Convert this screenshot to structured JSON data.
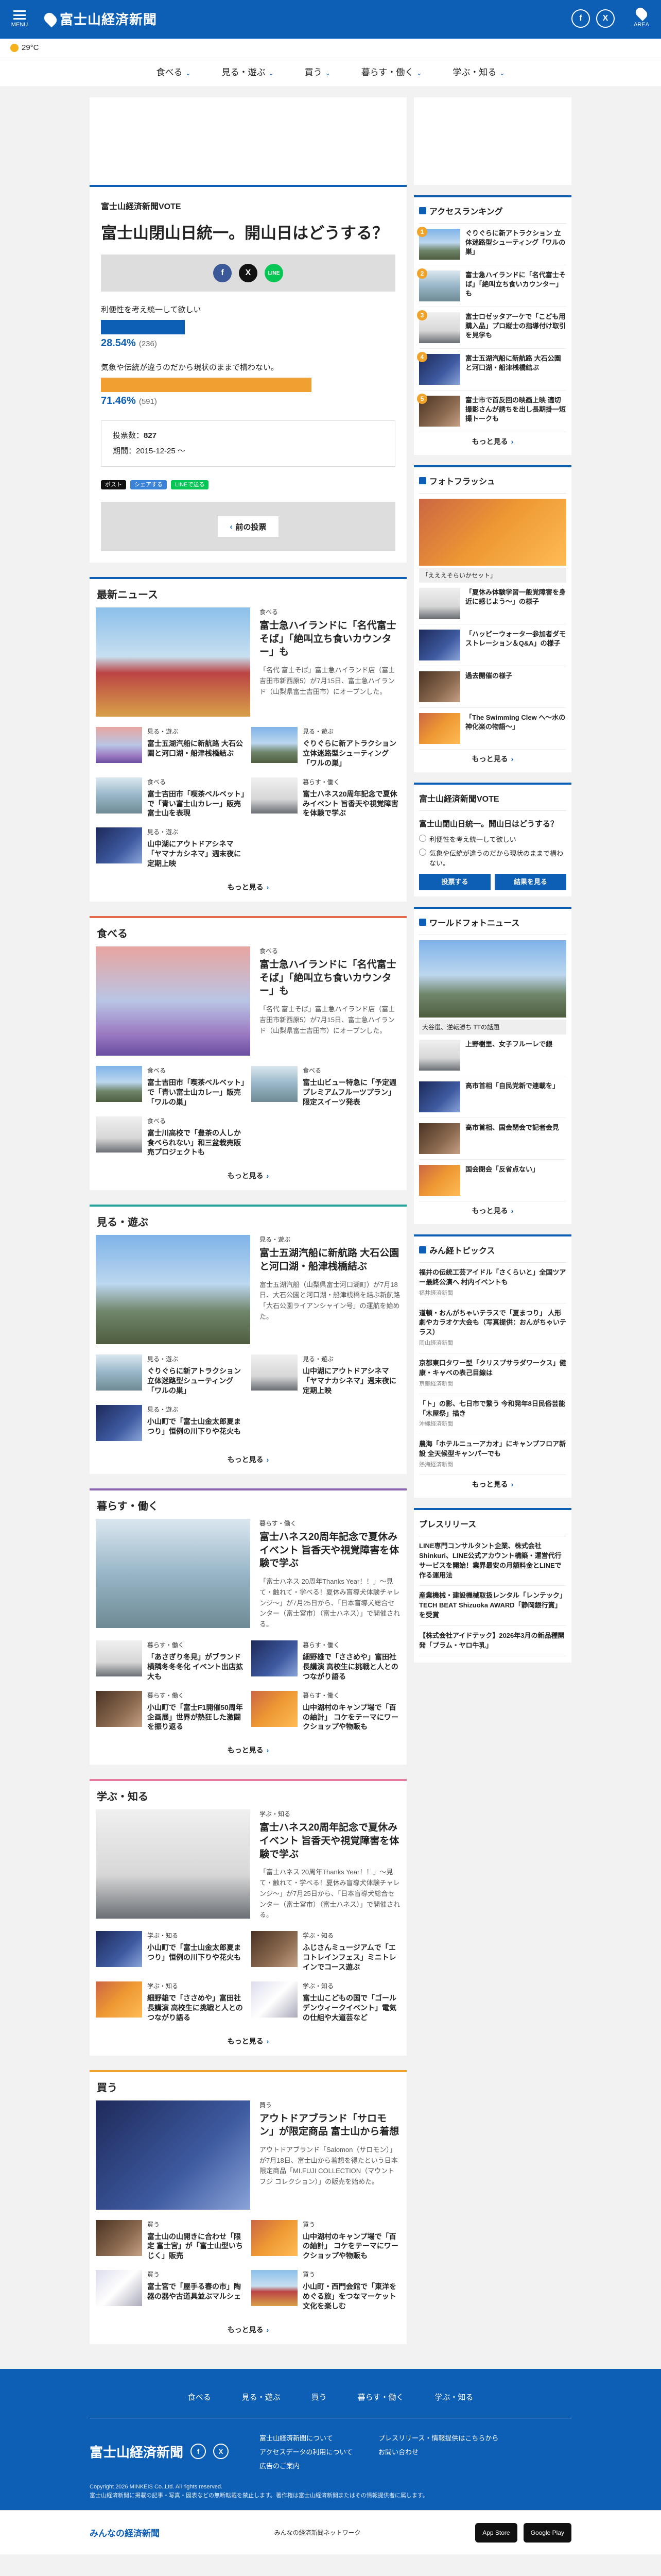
{
  "header": {
    "menu_label": "MENU",
    "site_name": "富士山経済新聞",
    "site_sub": "minkei",
    "area_label": "AREA",
    "sns": [
      "f",
      "X"
    ]
  },
  "weather": {
    "temp": "29°C"
  },
  "nav": [
    "食べる",
    "見る・遊ぶ",
    "買う",
    "暮らす・働く",
    "学ぶ・知る"
  ],
  "vote": {
    "label": "富士山経済新聞VOTE",
    "question": "富士山閉山日統一。開山日はどうする？",
    "share_icons": [
      "f",
      "X",
      "LINE"
    ],
    "options": [
      {
        "text": "利便性を考え統一して欲しい",
        "pct": "28.54%",
        "count": "(236)",
        "ratio": 0.2854,
        "color": "#0d5fb5"
      },
      {
        "text": "気象や伝統が違うのだから現状のままで構わない。",
        "pct": "71.46%",
        "count": "(591)",
        "ratio": 0.7146,
        "color": "#f0a030"
      }
    ],
    "total_label": "投票数：",
    "total": "827",
    "period": "期間：2015-12-25 〜",
    "mini": [
      "ポスト",
      "シェアする",
      "LINEで送る"
    ],
    "prev": "前の投票"
  },
  "sections": [
    {
      "key": "news",
      "cls": "",
      "title": "最新ニュース",
      "lead": {
        "cat": "食べる",
        "title": "富士急ハイランドに「名代富士そば」「絶叫立ち食いカウンター」も",
        "desc": "「名代 富士そば」富士急ハイランド店（富士吉田市新西原5）が7月15日、富士急ハイランド（山梨県富士吉田市）にオープンした。"
      },
      "items": [
        {
          "cat": "見る・遊ぶ",
          "title": "富士五湖汽船に新航路 大石公園と河口湖・船津桟橋結ぶ"
        },
        {
          "cat": "見る・遊ぶ",
          "title": "ぐりぐらに新アトラクション 立体迷路型シューティング「ワルの巣」"
        },
        {
          "cat": "食べる",
          "title": "富士吉田市「喫茶ベルベット」で「青い富士山カレー」販売 富士山を表現"
        },
        {
          "cat": "暮らす・働く",
          "title": "富士ハネス20周年記念で夏休みイベント 旨香天や視覚障害を体験で学ぶ"
        },
        {
          "cat": "見る・遊ぶ",
          "title": "山中湖にアウトドアシネマ「ヤマナカシネマ」週末夜に定期上映"
        }
      ]
    },
    {
      "key": "eat",
      "cls": "c-eat",
      "title": "食べる",
      "lead": {
        "cat": "食べる",
        "title": "富士急ハイランドに「名代富士そば」「絶叫立ち食いカウンター」も",
        "desc": "「名代 富士そば」富士急ハイランド店（富士吉田市新西原5）が7月15日、富士急ハイランド（山梨県富士吉田市）にオープンした。"
      },
      "items": [
        {
          "cat": "食べる",
          "title": "富士吉田市「喫茶ベルベット」で「青い富士山カレー」販売 「ワルの巣」"
        },
        {
          "cat": "食べる",
          "title": "富士山ビュー特急に「予定週プレミアムフルーツプラン」限定スイーツ発表"
        },
        {
          "cat": "食べる",
          "title": "富士川高校で「豊茶の人しか食べられない」和三盆栽売販売プロジェクトも"
        }
      ]
    },
    {
      "key": "play",
      "cls": "c-play",
      "title": "見る・遊ぶ",
      "lead": {
        "cat": "見る・遊ぶ",
        "title": "富士五湖汽船に新航路 大石公園と河口湖・船津桟橋結ぶ",
        "desc": "富士五湖汽船（山梨県富士河口湖町）が7月18日、大石公園と河口湖・船津桟橋を結ぶ新航路「大石公園ライアンシャイン号」の運航を始めた。"
      },
      "items": [
        {
          "cat": "見る・遊ぶ",
          "title": "ぐりぐらに新アトラクション 立体迷路型シューティング「ワルの巣」"
        },
        {
          "cat": "見る・遊ぶ",
          "title": "山中湖にアウトドアシネマ「ヤマナカシネマ」週末夜に定期上映"
        },
        {
          "cat": "見る・遊ぶ",
          "title": "小山町で「富士山金太郎夏まつり」恒例の川下りや花火も"
        }
      ]
    },
    {
      "key": "live",
      "cls": "c-live",
      "title": "暮らす・働く",
      "lead": {
        "cat": "暮らす・働く",
        "title": "富士ハネス20周年記念で夏休みイベント 旨香天や視覚障害を体験で学ぶ",
        "desc": "「富士ハネス 20周年Thanks Year！！」〜見て・触れて・学べる！夏休み盲導犬体験チャレンジ〜」が7月25日から、「日本盲導犬総合センター（富士宮市）（富士ハネス）」で開催される。"
      },
      "items": [
        {
          "cat": "暮らす・働く",
          "title": "「あさぎり冬見」がブランド横隣冬冬冬化 イベント出店拡大も"
        },
        {
          "cat": "暮らす・働く",
          "title": "細野雄で「ささめや」富田社長講演 高校生に挑戦と人とのつながり語る"
        },
        {
          "cat": "暮らす・働く",
          "title": "小山町で「富士F1開催50周年企画展」世界が熱狂した激闘を振り返る"
        },
        {
          "cat": "暮らす・働く",
          "title": "山中湖村のキャンプ場で「百の紬計」 コケをテーマにワークショップや物販も"
        }
      ]
    },
    {
      "key": "learn",
      "cls": "c-learn",
      "title": "学ぶ・知る",
      "lead": {
        "cat": "学ぶ・知る",
        "title": "富士ハネス20周年記念で夏休みイベント 旨香天や視覚障害を体験で学ぶ",
        "desc": "「富士ハネス 20周年Thanks Year！！」〜見て・触れて・学べる！夏休み盲導犬体験チャレンジ〜」が7月25日から、「日本盲導犬総合センター（富士宮市）（富士ハネス）」で開催される。"
      },
      "items": [
        {
          "cat": "学ぶ・知る",
          "title": "小山町で「富士山金太郎夏まつり」恒例の川下りや花火も"
        },
        {
          "cat": "学ぶ・知る",
          "title": "ふじさんミュージアムで「エコトレインフェス」ミニトレインでコース遊ぶ"
        },
        {
          "cat": "学ぶ・知る",
          "title": "細野雄で「ささめや」富田社長講演 高校生に挑戦と人とのつながり語る"
        },
        {
          "cat": "学ぶ・知る",
          "title": "富士山こどもの国で「ゴールデンウィークイベント」電気の仕組や大道芸など"
        }
      ]
    },
    {
      "key": "buy",
      "cls": "c-buy",
      "title": "買う",
      "lead": {
        "cat": "買う",
        "title": "アウトドアブランド「サロモン」が限定商品 富士山から着想",
        "desc": "アウトドアブランド「Salomon（サロモン）」が7月18日、富士山から着想を得たという日本限定商品「MI.FUJI COLLECTION（マウントフジ コレクション）」の販売を始めた。"
      },
      "items": [
        {
          "cat": "買う",
          "title": "富士山の山開きに合わせ「限定 富士宮」が「富士山型いちじく」販売"
        },
        {
          "cat": "買う",
          "title": "山中湖村のキャンプ場で「百の紬計」 コケをテーマにワークショップや物販も"
        },
        {
          "cat": "買う",
          "title": "富士宮で「屋手る春の市」陶器の器や古道具並ぶマルシェ"
        },
        {
          "cat": "買う",
          "title": "小山町・西門会館で「東洋をめぐる旅」をつなマーケット文化を楽しむ"
        }
      ]
    }
  ],
  "more": "もっと見る",
  "ranking": {
    "title": "アクセスランキング",
    "items": [
      "ぐりぐらに新アトラクション 立体迷路型シューティング「ワルの巣」",
      "富士急ハイランドに「名代富士そば」「絶叫立ち食いカウンター」も",
      "富士ロゼッタアーケで「こども用購入品」プロ縦士の指導付け取引を見学も",
      "富士五湖汽船に新航路 大石公園と河口湖・船津桟橋結ぶ",
      "富士市で首反回の映画上映 適切撮影さんが誘ちを出し長期掛一短撮トークも"
    ]
  },
  "photoflash": {
    "title": "フォトフラッシュ",
    "caption": "「えええそらいかセット」",
    "items": [
      "「夏休み体験学習一般覚障害を身近に感じよう〜」の様子",
      "「ハッピーウォーター参加者ダモストレーション＆Q&A」の様子",
      "過去開催の様子",
      "「The Swimming Clew ヘ〜水の神化楽の物語〜」"
    ]
  },
  "side_vote": {
    "title": "富士山経済新聞VOTE",
    "q": "富士山閉山日統一。開山日はどうする？",
    "opts": [
      "利便性を考え統一して欲しい",
      "気象や伝統が違うのだから現状のままで構わない。"
    ],
    "btn1": "投票する",
    "btn2": "結果を見る"
  },
  "world": {
    "title": "ワールドフォトニュース",
    "caption": "大谷選、逆転勝ち  TTの話題",
    "items": [
      "上野樹里、女子フルーレで銀",
      "高市首相「自民党新で連載を」",
      "高市首相、国会閉会で記者会見",
      "国会閉会「反省点ない」"
    ]
  },
  "topics": {
    "title": "みん経トピックス",
    "items": [
      {
        "t": "福井の伝統工芸アイドル「さくらいと」全国ツアー最終公演へ 村内イベントも",
        "s": "福井経済新聞"
      },
      {
        "t": "道頓・おんがちゃいテラスで「夏まつり」 人形劇やカラオケ大会も（写真提供：おんがちゃいテラス）",
        "s": "岡山経済新聞"
      },
      {
        "t": "京都東口タワー型「クリスプサラダワークス」健康・キャベの表己目線は",
        "s": "京都経済新聞"
      },
      {
        "t": "「ト」の影、七日市で繁う 今和発年8日民俗芸能「木屋祭」描き",
        "s": "沖縄経済新聞"
      },
      {
        "t": "農海「ホテルニューアカオ」にキャンプフロア新設 全天候型キャンパーでも",
        "s": "熱海経済新聞"
      }
    ]
  },
  "press": {
    "title": "プレスリリース",
    "items": [
      "LINE専門コンサルタント企業、株式会社Shinkuri、LINE公式アカウント構築・運営代行サービスを開始！業界最安の月額料金とLINEで作る運用法",
      "産業機械・建設機械取扱レンタル「レンテック」TECH BEAT Shizuoka AWARD「静岡銀行賞」を受賞",
      "【株式会社アイドテック】2026年3月の新品種開発「プラム・ヤロ牛乳」"
    ]
  },
  "footer": {
    "nav": [
      "食べる",
      "見る・遊ぶ",
      "買う",
      "暮らす・働く",
      "学ぶ・知る"
    ],
    "logo": "富士山経済新聞",
    "links": [
      "富士山経済新聞について",
      "プレスリリース・情報提供はこちらから",
      "アクセスデータの利用について",
      "お問い合わせ",
      "広告のご案内"
    ],
    "copy1": "Copyright 2026 MINKEIS Co.,Ltd. All rights reserved.",
    "copy2": "富士山経済新聞に掲載の記事・写真・図表などの無断転載を禁止します。著作権は富士山経済新聞またはその情報提供者に属します。",
    "mk": "みんなの経済新聞",
    "net": "みんなの経済新聞ネットワーク",
    "download": "アプリ Download",
    "stores": [
      "App Store",
      "Google Play"
    ]
  },
  "colors": {
    "primary": "#0d5fb5",
    "eat": "#e56a4a",
    "play": "#23a39a",
    "live": "#8a62b0",
    "learn": "#e57aa0",
    "buy": "#f0a32b"
  }
}
